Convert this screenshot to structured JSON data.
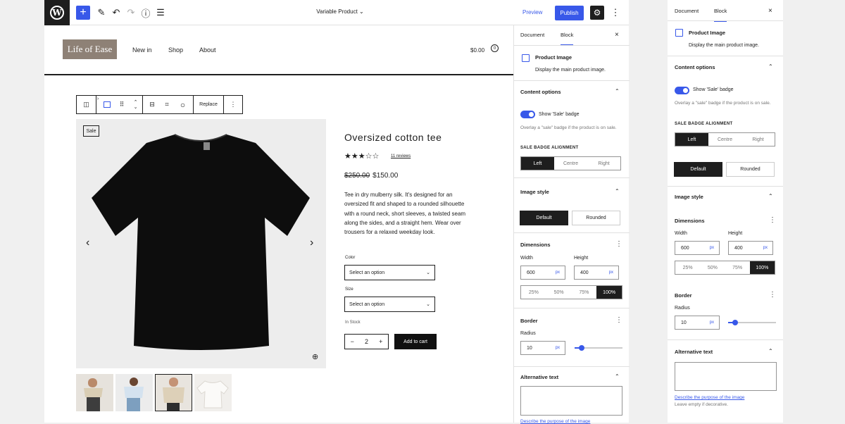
{
  "toolbar": {
    "wp_logo": "W",
    "add_icon": "+",
    "doc_title": "Variable Product",
    "preview": "Preview",
    "publish": "Publish",
    "settings_icon": "⚙",
    "more_icon": "⋮"
  },
  "site": {
    "logo": "Life of Ease",
    "nav": [
      "New in",
      "Shop",
      "About"
    ],
    "cart_total": "$0.00",
    "cart_count": "0"
  },
  "block_toolbar": {
    "replace": "Replace"
  },
  "product": {
    "sale_badge": "Sale",
    "title": "Oversized cotton tee",
    "stars": "★★★☆☆",
    "reviews": "11 reviews",
    "old_price": "$250.00",
    "price": "$150.00",
    "description": "Tee in dry mulberry silk. It's designed for an oversized fit and shaped to a rounded silhouette with a round neck, short sleeves, a twisted seam along the sides, and a straight hem. Wear over trousers for a relaxed weekday look.",
    "color_label": "Color",
    "color_placeholder": "Select an option",
    "size_label": "Size",
    "size_placeholder": "Select an option",
    "stock": "In Stock",
    "qty_minus": "−",
    "qty": "2",
    "qty_plus": "+",
    "add_to_cart": "Add to cart"
  },
  "panel": {
    "tab_document": "Document",
    "tab_block": "Block",
    "close": "×",
    "block_name": "Product Image",
    "block_desc": "Display the main product image.",
    "content_options": "Content options",
    "toggle_label": "Show 'Sale' badge",
    "toggle_help": "Overlay a \"sale\" badge if the product is on sale.",
    "badge_alignment": "SALE BADGE ALIGNMENT",
    "align_options": [
      "Left",
      "Centre",
      "Right"
    ],
    "image_style": "Image style",
    "style_default": "Default",
    "style_rounded": "Rounded",
    "dimensions": "Dimensions",
    "width_label": "Width",
    "width_value": "600",
    "height_label": "Height",
    "height_value": "400",
    "unit": "px",
    "scale_options": [
      "25%",
      "50%",
      "75%",
      "100%"
    ],
    "border": "Border",
    "radius_label": "Radius",
    "radius_value": "10",
    "radius_fraction": 0.15,
    "alt_text": "Alternative text",
    "alt_link": "Describe the purpose of the image",
    "alt_help": "Leave empty if decorative."
  }
}
